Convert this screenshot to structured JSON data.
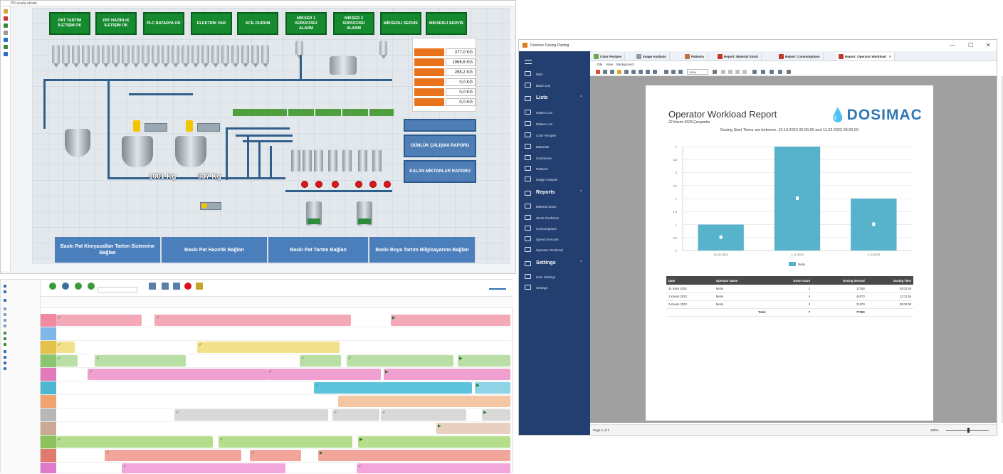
{
  "scada": {
    "window_title": "PR scada ekrani",
    "top_buttons": [
      "PAT TARTIM İLETİŞİM OK",
      "PAT HAZIRLIK İLETİŞİM OK",
      "PLC BATARYA OK",
      "ELEKTRİK VAR",
      "ACİL DURUM",
      "MİKSER 1 SÜRÜCÜSÜ ALARM",
      "MİKSER 2 SÜRÜCÜSÜ ALARM",
      "MİKSERLİ SERVİS",
      "MİKSERLİ SERVİS"
    ],
    "quantities": [
      "377,0 KG",
      "1966,6 KG",
      "268,2 KG",
      "0,0 KG",
      "0,0 KG",
      "0,0 KG"
    ],
    "tank1_kg": "1001 Kg",
    "tank2_kg": "937 Kg",
    "side_buttons": [
      "GÜNLÜK ÇALIŞMA RAPORU",
      "KALAN MİKTARLAR RAPORU"
    ],
    "bottom_buttons": [
      "Baskı Pat Kimyasalları Tartım Sistemine Bağlan",
      "Baskı Pat Hazırlık Bağlan",
      "Baskı Pat Tartım Bağlan",
      "Baskı Boya Tartım Bilgisayarına Bağlan"
    ],
    "colors": {
      "green": "#168a2e",
      "blue_button": "#4b7fbb",
      "orange": "#e8731c",
      "red_valve": "#e0161b"
    }
  },
  "gantt": {
    "colors": [
      "#f4a9b8",
      "#aad8f0",
      "#f3e08a",
      "#b9dfa6",
      "#ef9fd0",
      "#8fd3e6",
      "#f4c6a3",
      "#d8d8d8",
      "#e8cfc0",
      "#b5de8c",
      "#f2a59a",
      "#f3a6dc"
    ]
  },
  "report": {
    "window_title": "Dosimac Dosing Pasting",
    "window_controls": [
      "—",
      "☐",
      "✕"
    ],
    "nav": {
      "top_items": [
        "Main",
        "Batch List"
      ],
      "lists_title": "Lists",
      "lists": [
        "Pattern List",
        "Pattern List",
        "Color Recipes",
        "Materials",
        "Customers",
        "Patterns",
        "Image Analysis"
      ],
      "reports_title": "Reports",
      "reports": [
        "Material Stock",
        "Stock Prediction",
        "Consumptions",
        "Spend Amounts",
        "Operator Workload"
      ],
      "settings_title": "Settings",
      "settings": [
        "User Settings",
        "Settings"
      ]
    },
    "tabs": [
      "Color Recipes",
      "Image Analysis",
      "Patterns",
      "Report: Material Stock",
      "Report: Consumptions",
      "Report: Operator Workload"
    ],
    "menu": [
      "File",
      "View",
      "Background"
    ],
    "zoom": "100%",
    "page_status": "Page 1 of 1",
    "zoom_status": "100%",
    "page": {
      "title": "Operator Workload Report",
      "date": "22 Kasım 2023 Çarşamba",
      "subtitle": "Dosing Start Times are between:  10.10.2023 00:00:00  and  11.23.2023 00:00:00",
      "logo": "DOSIMAC",
      "table_headers": [
        "Date",
        "Operator Name",
        "Dose Count",
        "Dosing Second",
        "Dosing Time"
      ],
      "table_rows": [
        [
          "31 Ekim 2023",
          "Metin",
          "1",
          "17108",
          "03:02:28"
        ],
        [
          "1 Kasım 2023",
          "Metin",
          "4",
          "44073",
          "12:11:55"
        ],
        [
          "2 Kasım 2023",
          "Metin",
          "2",
          "21970",
          "00:04:30"
        ]
      ],
      "total_label": "Total:",
      "total_count": "7",
      "total_seconds": "77200"
    }
  },
  "chart_data": {
    "type": "bar",
    "categories": [
      "31.10.2023",
      "1.11.2023",
      "2.11.2023"
    ],
    "series": [
      {
        "name": "Metin",
        "values": [
          1,
          4,
          2
        ]
      }
    ],
    "title": "",
    "xlabel": "",
    "ylabel": "",
    "ylim": [
      0,
      4
    ],
    "yticks": [
      "0",
      "0,5",
      "1",
      "1,5",
      "2",
      "2,5",
      "3",
      "3,5",
      "4"
    ],
    "grid": true,
    "legend": "bottom",
    "color": "#57b3cc"
  }
}
